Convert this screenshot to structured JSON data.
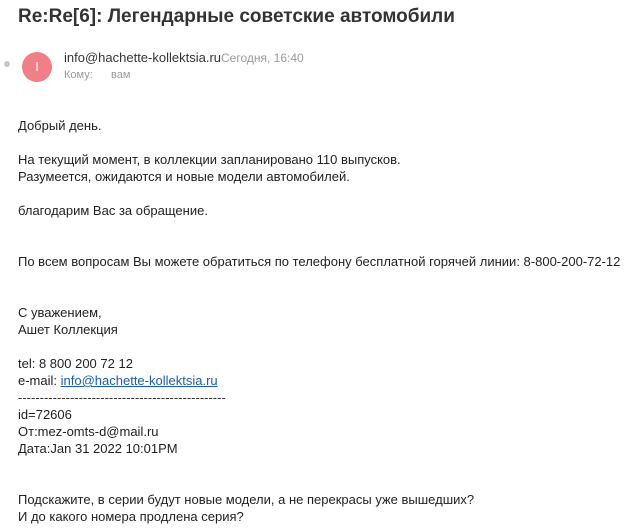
{
  "subject": "Re:Re[6]: Легендарные советские автомобили",
  "header": {
    "avatar_letter": "I",
    "sender": "info@hachette-kollektsia.ru",
    "date": "Сегодня, 16:40",
    "to_label": "Кому:",
    "to_value": "вам"
  },
  "body": {
    "greeting": "Добрый день.",
    "line1": "На текущий момент, в коллекции запланировано 110 выпусков.",
    "line2": "Разумеется, ожидаются и новые модели автомобилей.",
    "thanks": "благодарим Вас за обращение.",
    "hotline": "По всем вопросам Вы можете обратиться по телефону бесплатной горячей линии: 8-800-200-72-12",
    "regards": "С уважением,",
    "signature": "Ашет Коллекция",
    "tel": "tel: 8 800 200 72 12",
    "email_label": "e-mail: ",
    "email_link": "info@hachette-kollektsia.ru",
    "separator": "------------------------------------------------",
    "id": "id=72606",
    "from": "От:mez-omts-d@mail.ru",
    "sent_date": "Дата:Jan 31 2022 10:01PM",
    "question1": "Подскажите, в серии будут новые модели, а не перекрасы уже вышедших?",
    "question2": "И до какого номера продлена серия?"
  }
}
